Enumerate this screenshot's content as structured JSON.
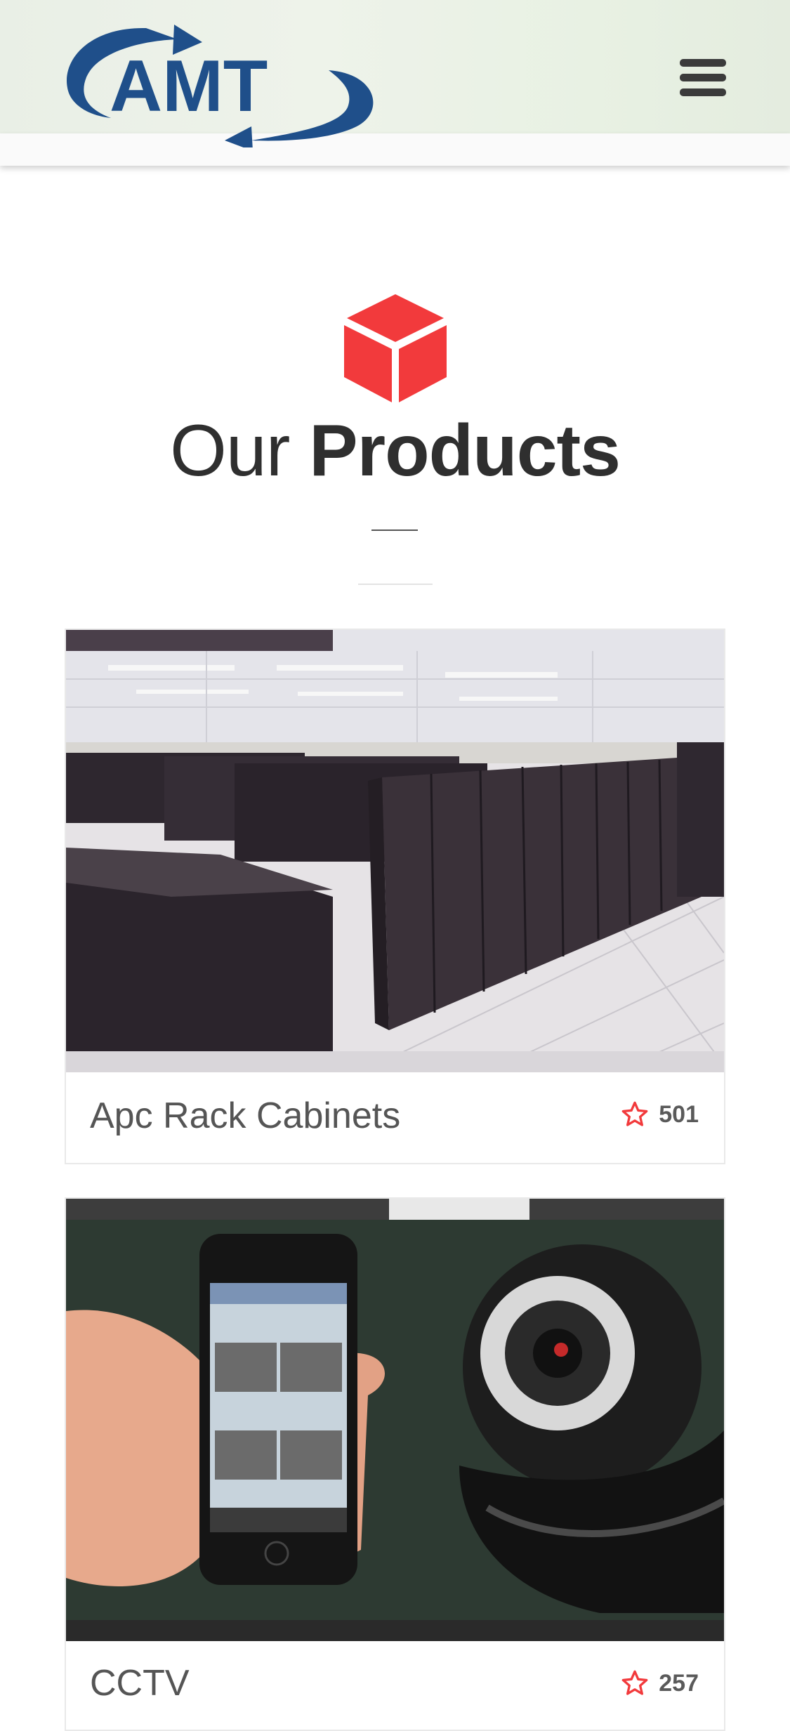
{
  "header": {
    "logo_text": "AMT",
    "menu_icon": "hamburger-menu-icon"
  },
  "section": {
    "icon": "cube-icon",
    "title_light": "Our",
    "title_bold": "Products"
  },
  "products": [
    {
      "name": "Apc Rack Cabinets",
      "rating_count": "501",
      "image": "server-room-rack-cabinets"
    },
    {
      "name": "CCTV",
      "rating_count": "257",
      "image": "smartphone-and-ip-camera"
    }
  ],
  "colors": {
    "brand_blue": "#1f4f8a",
    "accent_red": "#f23a3c",
    "text_dark": "#2f2f2f"
  }
}
